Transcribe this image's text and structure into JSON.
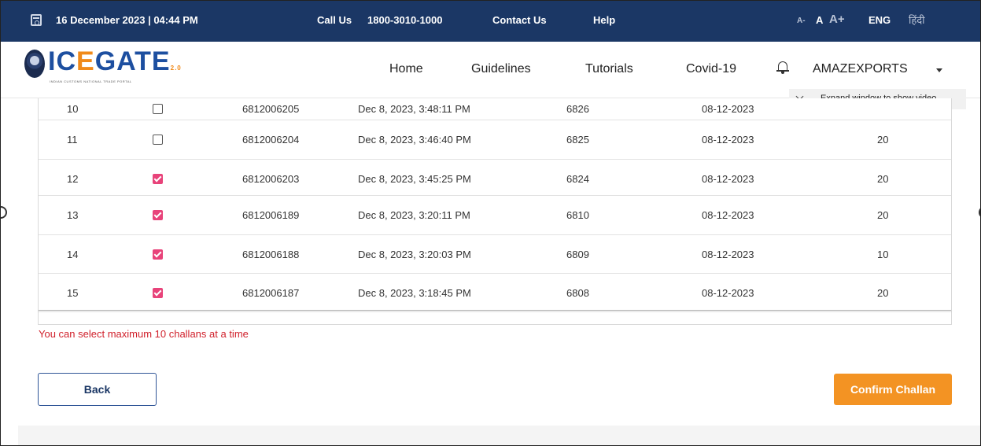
{
  "topbar": {
    "datetime": "16 December 2023 | 04:44 PM",
    "call_label": "Call Us",
    "call_number": "1800-3010-1000",
    "contact": "Contact Us",
    "help": "Help",
    "font_small": "A-",
    "font_normal": "A",
    "font_large": "A+",
    "lang_en": "ENG",
    "lang_hi": "हिंदी"
  },
  "header": {
    "logo_main": "IC",
    "logo_o": "E",
    "logo_rest": "GATE",
    "logo_suffix": "2.0",
    "logo_tagline": "INDIAN CUSTOMS NATIONAL TRADE PORTAL",
    "nav": [
      "Home",
      "Guidelines",
      "Tutorials",
      "Covid-19"
    ],
    "user": "AMAZEXPORTS"
  },
  "video_tip": "Expand window to show video",
  "table": {
    "rows": [
      {
        "sno": "10",
        "checked": false,
        "challan": "6812006205",
        "datetime": "Dec 8, 2023, 3:48:11 PM",
        "num": "6826",
        "date": "08-12-2023",
        "qty": ""
      },
      {
        "sno": "11",
        "checked": false,
        "challan": "6812006204",
        "datetime": "Dec 8, 2023, 3:46:40 PM",
        "num": "6825",
        "date": "08-12-2023",
        "qty": "20"
      },
      {
        "sno": "12",
        "checked": true,
        "challan": "6812006203",
        "datetime": "Dec 8, 2023, 3:45:25 PM",
        "num": "6824",
        "date": "08-12-2023",
        "qty": "20"
      },
      {
        "sno": "13",
        "checked": true,
        "challan": "6812006189",
        "datetime": "Dec 8, 2023, 3:20:11 PM",
        "num": "6810",
        "date": "08-12-2023",
        "qty": "20"
      },
      {
        "sno": "14",
        "checked": true,
        "challan": "6812006188",
        "datetime": "Dec 8, 2023, 3:20:03 PM",
        "num": "6809",
        "date": "08-12-2023",
        "qty": "10"
      },
      {
        "sno": "15",
        "checked": true,
        "challan": "6812006187",
        "datetime": "Dec 8, 2023, 3:18:45 PM",
        "num": "6808",
        "date": "08-12-2023",
        "qty": "20"
      }
    ]
  },
  "error_message": "You can select maximum 10 challans at a time",
  "buttons": {
    "back": "Back",
    "confirm": "Confirm Challan"
  },
  "colors": {
    "topbar_bg": "#1b3765",
    "checkbox_checked": "#e8437a",
    "confirm_bg": "#f39323",
    "error_text": "#d01f2a"
  }
}
